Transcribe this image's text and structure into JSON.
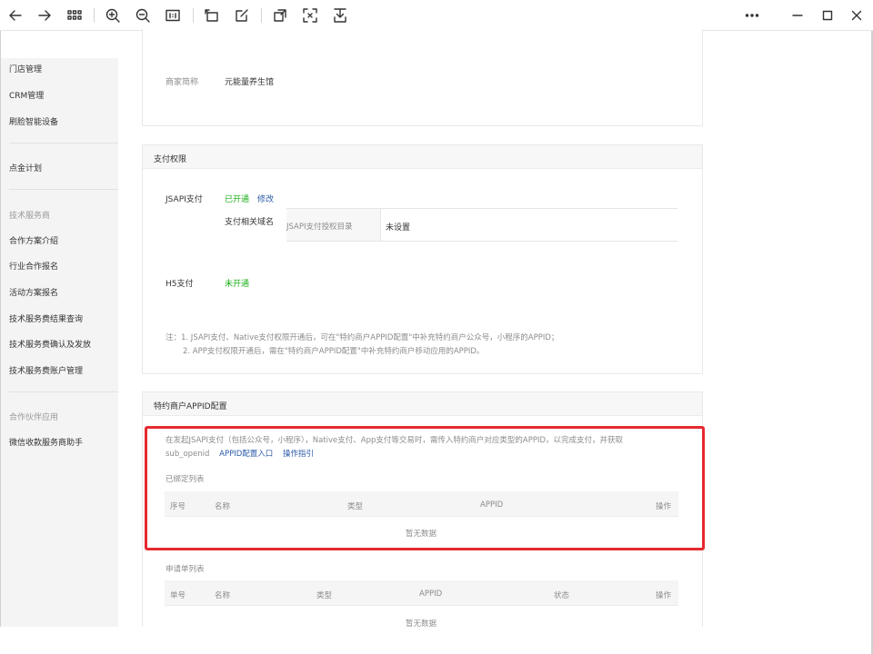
{
  "toolbar": {
    "icons": [
      "back-arrow-icon",
      "forward-arrow-icon",
      "grid-view-icon",
      "zoom-in-icon",
      "zoom-out-icon",
      "actual-size-icon",
      "rotate-icon",
      "edit-icon",
      "crop-icon",
      "ocr-icon",
      "download-icon",
      "more-icon",
      "minimize-icon",
      "maximize-icon",
      "close-icon"
    ]
  },
  "sidebar": {
    "items_top": [
      "门店管理",
      "CRM管理",
      "刷脸智能设备"
    ],
    "item_mid": "点金计划",
    "group_tech": "技术服务商",
    "items_tech": [
      "合作方案介绍",
      "行业合作报名",
      "活动方案报名",
      "技术服务费结果查询",
      "技术服务费确认及发放",
      "技术服务费账户管理"
    ],
    "group_partner": "合作伙伴应用",
    "items_partner": [
      "微信收款服务商助手"
    ]
  },
  "merchant": {
    "label": "商家简称",
    "value": "元能量养生馆"
  },
  "payment_perm": {
    "title": "支付权限",
    "jsapi_label": "JSAPI支付",
    "jsapi_status": "已开通",
    "jsapi_modify": "修改",
    "domain_label": "支付相关域名",
    "domain_key": "JSAPI支付授权目录",
    "domain_value": "未设置",
    "h5_label": "H5支付",
    "h5_status": "未开通",
    "note1": "注：1. JSAPI支付、Native支付权限开通后，可在\"特约商户APPID配置\"中补充特约商户公众号，小程序的APPID；",
    "note2": "2. APP支付权限开通后，需在\"特约商户APPID配置\"中补充特约商户移动应用的APPID。"
  },
  "appid": {
    "title": "特约商户APPID配置",
    "desc1": "在发起JSAPI支付（包括公众号，小程序），Native支付、App支付等交易时，需传入特约商户对应类型的APPID，以完成支付，并获取",
    "desc2_prefix": "sub_openid",
    "link_config": "APPID配置入口",
    "link_guide": "操作指引",
    "bound_title": "已绑定列表",
    "bound_headers": [
      "序号",
      "名称",
      "类型",
      "APPID",
      "操作"
    ],
    "bound_empty": "暂无数据",
    "apply_title": "申请单列表",
    "apply_headers": [
      "单号",
      "名称",
      "类型",
      "APPID",
      "状态",
      "操作"
    ],
    "apply_empty": "暂无数据"
  },
  "colors": {
    "accent_green": "#1aad19",
    "link_blue": "#2b5aaa",
    "highlight_red": "#e5292f"
  }
}
